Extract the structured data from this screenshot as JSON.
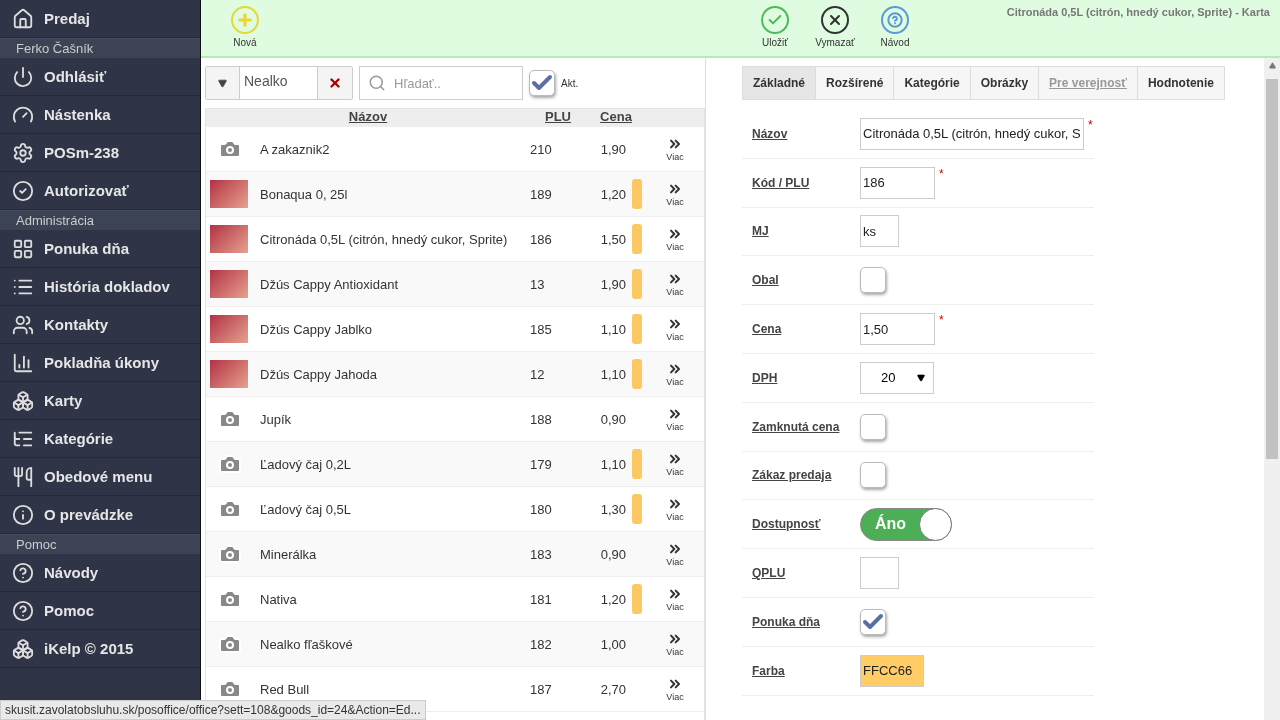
{
  "sidebar": {
    "sections": [
      {
        "items": [
          {
            "label": "Predaj"
          }
        ]
      },
      {
        "header": "Ferko Čašník",
        "items": [
          {
            "label": "Odhlásiť"
          },
          {
            "label": "Nástenka"
          },
          {
            "label": "POSm-238"
          },
          {
            "label": "Autorizovať"
          }
        ]
      },
      {
        "header": "Administrácia",
        "items": [
          {
            "label": "Ponuka dňa"
          },
          {
            "label": "História dokladov"
          },
          {
            "label": "Kontakty"
          },
          {
            "label": "Pokladňa úkony"
          },
          {
            "label": "Karty"
          },
          {
            "label": "Kategórie"
          },
          {
            "label": "Obedové menu"
          },
          {
            "label": "O prevádzke"
          }
        ]
      },
      {
        "header": "Pomoc",
        "items": [
          {
            "label": "Návody"
          },
          {
            "label": "Pomoc"
          },
          {
            "label": "iKelp © 2015"
          }
        ]
      }
    ]
  },
  "toolbar": {
    "left": [
      {
        "label": "Nová"
      }
    ],
    "right": [
      {
        "label": "Uložiť"
      },
      {
        "label": "Vymazať"
      },
      {
        "label": "Návod"
      }
    ],
    "title": "Citronáda 0,5L (citrón, hnedý cukor, Sprite) - Karta"
  },
  "filter": {
    "category": "Nealko",
    "search_placeholder": "Hľadať..",
    "active_label": "Akt.",
    "active_checked": true
  },
  "table": {
    "columns": [
      "Názov",
      "PLU",
      "Cena"
    ],
    "rows": [
      {
        "kind": "camera",
        "name": "A zakaznik2",
        "plu": "210",
        "price": "1,90",
        "more": "Viac"
      },
      {
        "kind": "photo",
        "name": "Bonaqua 0, 25l",
        "plu": "189",
        "price": "1,20",
        "color": "#fcc862",
        "more": "Viac"
      },
      {
        "kind": "photo",
        "name": "Citronáda 0,5L (citrón, hnedý cukor, Sprite)",
        "plu": "186",
        "price": "1,50",
        "color": "#fcc862",
        "more": "Viac"
      },
      {
        "kind": "photo",
        "name": "Džús Cappy Antioxidant",
        "plu": "13",
        "price": "1,90",
        "color": "#fcc862",
        "more": "Viac"
      },
      {
        "kind": "photo",
        "name": "Džús Cappy Jablko",
        "plu": "185",
        "price": "1,10",
        "color": "#fcc862",
        "more": "Viac"
      },
      {
        "kind": "photo",
        "name": "Džús Cappy Jahoda",
        "plu": "12",
        "price": "1,10",
        "color": "#fcc862",
        "more": "Viac"
      },
      {
        "kind": "camera",
        "name": "Jupík",
        "plu": "188",
        "price": "0,90",
        "more": "Viac"
      },
      {
        "kind": "camera",
        "name": "Ľadový čaj 0,2L",
        "plu": "179",
        "price": "1,10",
        "color": "#fcc862",
        "more": "Viac"
      },
      {
        "kind": "camera",
        "name": "Ľadový čaj 0,5L",
        "plu": "180",
        "price": "1,30",
        "color": "#fcc862",
        "more": "Viac"
      },
      {
        "kind": "camera",
        "name": "Minerálka",
        "plu": "183",
        "price": "0,90",
        "more": "Viac"
      },
      {
        "kind": "camera",
        "name": "Nativa",
        "plu": "181",
        "price": "1,20",
        "color": "#fcc862",
        "more": "Viac"
      },
      {
        "kind": "camera",
        "name": "Nealko fľaškové",
        "plu": "182",
        "price": "1,00",
        "more": "Viac"
      },
      {
        "kind": "camera",
        "name": "Red Bull",
        "plu": "187",
        "price": "2,70",
        "more": "Viac"
      }
    ]
  },
  "tabs": [
    {
      "label": "Základné",
      "selected": true,
      "hovered": false
    },
    {
      "label": "Rozšírené",
      "selected": false,
      "hovered": false
    },
    {
      "label": "Kategórie",
      "selected": false,
      "hovered": false
    },
    {
      "label": "Obrázky",
      "selected": false,
      "hovered": false
    },
    {
      "label": "Pre verejnosť",
      "selected": false,
      "hovered": true
    },
    {
      "label": "Hodnotenie",
      "selected": false,
      "hovered": false
    }
  ],
  "form": [
    {
      "kind": "wide-text",
      "label": "Názov",
      "value": "Citronáda 0,5L (citrón, hnedý cukor, S",
      "required_mark": "*"
    },
    {
      "kind": "text",
      "label": "Kód / PLU",
      "value": "186",
      "required_mark": "*"
    },
    {
      "kind": "short-text",
      "label": "MJ",
      "value": "ks"
    },
    {
      "kind": "checkbox",
      "label": "Obal",
      "checked": false
    },
    {
      "kind": "text",
      "label": "Cena",
      "value": "1,50",
      "required_mark": "*"
    },
    {
      "kind": "select",
      "label": "DPH",
      "value": "20"
    },
    {
      "kind": "checkbox",
      "label": "Zamknutá cena",
      "checked": false
    },
    {
      "kind": "checkbox",
      "label": "Zákaz predaja",
      "checked": false
    },
    {
      "kind": "toggle",
      "label": "Dostupnosť",
      "on": true,
      "value": "Áno"
    },
    {
      "kind": "short-text",
      "label": "QPLU"
    },
    {
      "kind": "checkbox",
      "label": "Ponuka dňa",
      "checked": true
    },
    {
      "kind": "color",
      "label": "Farba",
      "value": "FFCC66",
      "color": "#ffcc66"
    }
  ],
  "status_bar": "skusit.zavolatobsluhu.sk/posoffice/office?sett=108&goods_id=24&Action=Ed..."
}
